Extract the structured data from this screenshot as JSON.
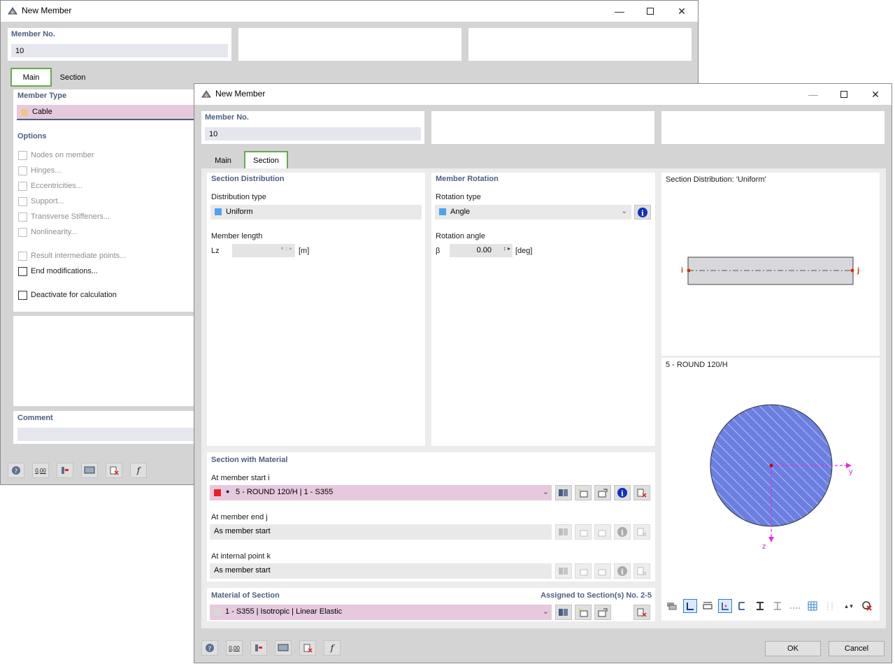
{
  "back": {
    "title": "New Member",
    "member_no_label": "Member No.",
    "member_no_value": "10",
    "tabs": [
      "Main",
      "Section"
    ],
    "member_type_label": "Member Type",
    "member_type_value": "Cable",
    "options_label": "Options",
    "options": [
      "Nodes on member",
      "Hinges...",
      "Eccentricities...",
      "Support...",
      "Transverse Stiffeners...",
      "Nonlinearity..."
    ],
    "result_points": "Result intermediate points...",
    "end_modifications": "End modifications...",
    "deactivate": "Deactivate for calculation",
    "comment_label": "Comment"
  },
  "front": {
    "title": "New Member",
    "member_no_label": "Member No.",
    "member_no_value": "10",
    "tabs": [
      "Main",
      "Section"
    ],
    "section_distribution": {
      "header": "Section Distribution",
      "type_label": "Distribution type",
      "type_value": "Uniform",
      "length_label": "Member length",
      "length_symbol": "Lz",
      "length_unit": "[m]"
    },
    "member_rotation": {
      "header": "Member Rotation",
      "type_label": "Rotation type",
      "type_value": "Angle",
      "angle_label": "Rotation angle",
      "angle_symbol": "β",
      "angle_value": "0.00",
      "angle_unit": "[deg]"
    },
    "preview": {
      "distribution_title": "Section Distribution: 'Uniform'",
      "node_i": "i",
      "node_j": "j",
      "section_title": "5 - ROUND 120/H",
      "axis_y": "y",
      "axis_z": "z"
    },
    "section_material": {
      "header": "Section with Material",
      "start_label": "At member start i",
      "start_value": "5 - ROUND 120/H | 1 - S355",
      "end_label": "At member end j",
      "end_value": "As member start",
      "internal_label": "At internal point k",
      "internal_value": "As member start"
    },
    "material": {
      "header": "Material of Section",
      "assigned": "Assigned to Section(s) No. 2-5",
      "value": "1 - S355 | Isotropic | Linear Elastic"
    },
    "ok_label": "OK",
    "cancel_label": "Cancel",
    "bottom_tool_value": "0,00"
  },
  "colors": {
    "accent_label": "#4d5f80",
    "tab_highlight": "#6aa84f",
    "cable_swatch": "#f4c484",
    "uniform_swatch": "#4da3f0",
    "section_red": "#e8202a",
    "section_fill": "#6a7fe0",
    "axis_magenta": "#e030e0",
    "node_red": "#cc3300"
  }
}
